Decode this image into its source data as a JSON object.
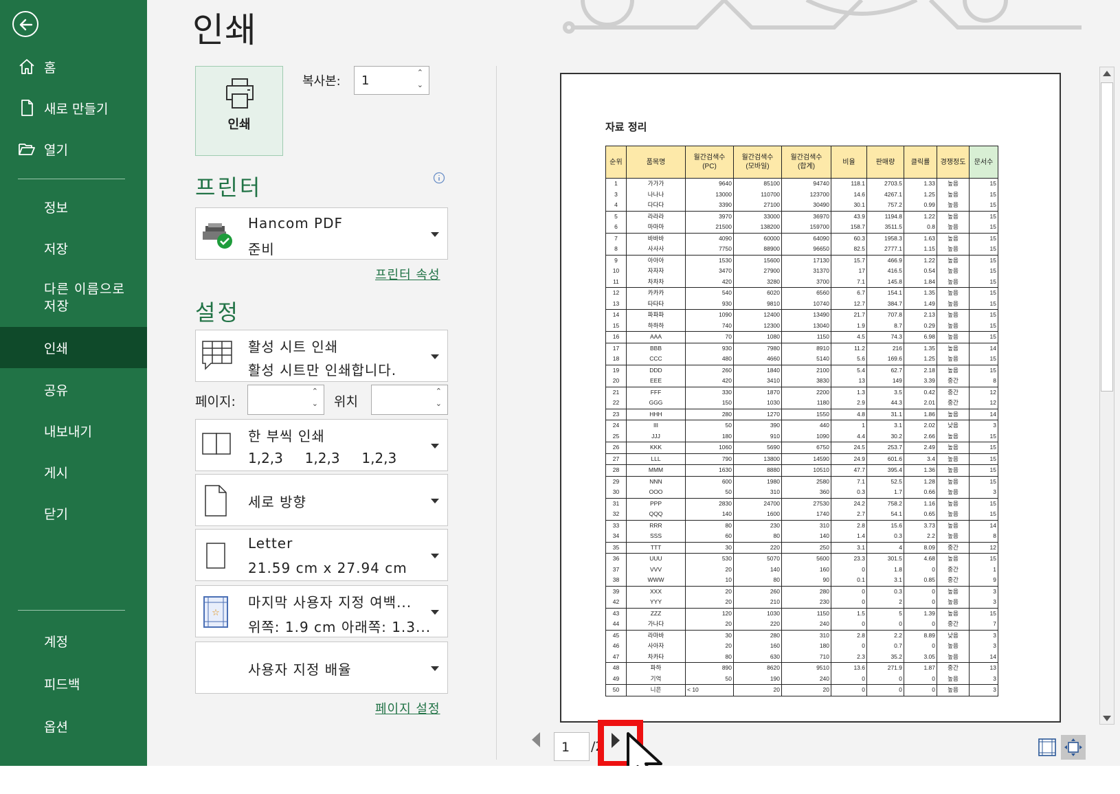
{
  "sidebar": {
    "back_icon": "back-arrow-icon",
    "items": [
      {
        "label": "홈",
        "icon": "home-icon"
      },
      {
        "label": "새로 만들기",
        "icon": "new-document-icon"
      },
      {
        "label": "열기",
        "icon": "folder-open-icon"
      },
      {
        "label": "정보"
      },
      {
        "label": "저장"
      },
      {
        "label": "다른 이름으로\n저장"
      },
      {
        "label": "인쇄"
      },
      {
        "label": "공유"
      },
      {
        "label": "내보내기"
      },
      {
        "label": "게시"
      },
      {
        "label": "닫기"
      }
    ],
    "bottom_items": [
      {
        "label": "계정"
      },
      {
        "label": "피드백"
      },
      {
        "label": "옵션"
      }
    ],
    "colors": {
      "bg": "#217346",
      "selected": "#0f4a2a"
    }
  },
  "page": {
    "title": "인쇄"
  },
  "print": {
    "button_label": "인쇄",
    "copies_label": "복사본:",
    "copies_value": "1"
  },
  "printer": {
    "section_title": "프린터",
    "name": "Hancom PDF",
    "status": "준비",
    "properties_link": "프린터 속성",
    "info_icon": "info-icon"
  },
  "settings": {
    "section_title": "설정",
    "scope": {
      "line1": "활성 시트 인쇄",
      "line2": "활성 시트만 인쇄합니다."
    },
    "pages_label": "페이지:",
    "position_label": "위치",
    "collate": {
      "line1": "한 부씩 인쇄",
      "line2": "1,2,3     1,2,3     1,2,3"
    },
    "orientation": {
      "line1": "세로 방향"
    },
    "paper": {
      "line1": "Letter",
      "line2": "21.59 cm x 27.94 cm"
    },
    "margins": {
      "line1": "마지막 사용자 지정 여백...",
      "line2": "위쪽: 1.9 cm 아래쪽: 1.3..."
    },
    "scaling": {
      "line1": "사용자 지정 배율"
    },
    "page_setup_link": "페이지 설정"
  },
  "preview": {
    "sheet_title": "자료 정리",
    "headers": [
      "순위",
      "품목명",
      "월간검색수\n(PC)",
      "월간검색수\n(모바일)",
      "월간검색수\n(합계)",
      "비율",
      "판매량",
      "클릭률",
      "경쟁정도",
      "문서수"
    ],
    "rows": [
      [
        "1",
        "가가가",
        "9640",
        "85100",
        "94740",
        "118.1",
        "2703.5",
        "1.33",
        "높음",
        "15"
      ],
      [
        "3",
        "나나나",
        "13000",
        "110700",
        "123700",
        "14.6",
        "4267.1",
        "1.25",
        "높음",
        "15"
      ],
      [
        "4",
        "다다다",
        "3390",
        "27100",
        "30490",
        "30.1",
        "757.2",
        "0.99",
        "높음",
        "15"
      ],
      [
        "5",
        "라라라",
        "3970",
        "33000",
        "36970",
        "43.9",
        "1194.8",
        "1.22",
        "높음",
        "15"
      ],
      [
        "6",
        "마마마",
        "21500",
        "138200",
        "159700",
        "158.7",
        "3511.5",
        "0.8",
        "높음",
        "15"
      ],
      [
        "7",
        "바바바",
        "4090",
        "60000",
        "64090",
        "60.3",
        "1958.3",
        "1.63",
        "높음",
        "15"
      ],
      [
        "8",
        "사사사",
        "7750",
        "88900",
        "96650",
        "82.5",
        "2777.1",
        "1.15",
        "높음",
        "15"
      ],
      [
        "9",
        "아아아",
        "1530",
        "15600",
        "17130",
        "15.7",
        "466.9",
        "1.22",
        "높음",
        "15"
      ],
      [
        "10",
        "자자자",
        "3470",
        "27900",
        "31370",
        "17",
        "416.5",
        "0.54",
        "높음",
        "15"
      ],
      [
        "11",
        "차차차",
        "420",
        "3280",
        "3700",
        "7.1",
        "145.8",
        "1.84",
        "높음",
        "15"
      ],
      [
        "12",
        "카카카",
        "540",
        "6020",
        "6560",
        "6.7",
        "154.1",
        "1.35",
        "높음",
        "15"
      ],
      [
        "13",
        "타타타",
        "930",
        "9810",
        "10740",
        "12.7",
        "384.7",
        "1.49",
        "높음",
        "15"
      ],
      [
        "14",
        "파파파",
        "1090",
        "12400",
        "13490",
        "21.7",
        "707.8",
        "2.13",
        "높음",
        "15"
      ],
      [
        "15",
        "하하하",
        "740",
        "12300",
        "13040",
        "1.9",
        "8.7",
        "0.29",
        "높음",
        "15"
      ],
      [
        "16",
        "AAA",
        "70",
        "1080",
        "1150",
        "4.5",
        "74.3",
        "6.98",
        "높음",
        "15"
      ],
      [
        "17",
        "BBB",
        "930",
        "7980",
        "8910",
        "11.2",
        "216",
        "1.35",
        "높음",
        "14"
      ],
      [
        "18",
        "CCC",
        "480",
        "4660",
        "5140",
        "5.6",
        "169.6",
        "1.25",
        "높음",
        "15"
      ],
      [
        "19",
        "DDD",
        "260",
        "1840",
        "2100",
        "5.4",
        "62.7",
        "2.18",
        "높음",
        "15"
      ],
      [
        "20",
        "EEE",
        "420",
        "3410",
        "3830",
        "13",
        "149",
        "3.39",
        "중간",
        "8"
      ],
      [
        "21",
        "FFF",
        "330",
        "1870",
        "2200",
        "1.3",
        "3.5",
        "0.42",
        "중간",
        "12"
      ],
      [
        "22",
        "GGG",
        "150",
        "1030",
        "1180",
        "2.9",
        "44.3",
        "2.01",
        "중간",
        "12"
      ],
      [
        "23",
        "HHH",
        "280",
        "1270",
        "1550",
        "4.8",
        "31.1",
        "1.86",
        "높음",
        "14"
      ],
      [
        "24",
        "III",
        "50",
        "390",
        "440",
        "1",
        "3.1",
        "2.02",
        "낮음",
        "3"
      ],
      [
        "25",
        "JJJ",
        "180",
        "910",
        "1090",
        "4.4",
        "30.2",
        "2.66",
        "높음",
        "15"
      ],
      [
        "26",
        "KKK",
        "1060",
        "5690",
        "6750",
        "24.5",
        "253.7",
        "2.49",
        "높음",
        "15"
      ],
      [
        "27",
        "LLL",
        "790",
        "13800",
        "14590",
        "24.9",
        "601.6",
        "3.4",
        "높음",
        "15"
      ],
      [
        "28",
        "MMM",
        "1630",
        "8880",
        "10510",
        "47.7",
        "395.4",
        "1.36",
        "높음",
        "15"
      ],
      [
        "29",
        "NNN",
        "600",
        "1980",
        "2580",
        "7.1",
        "52.5",
        "1.28",
        "높음",
        "15"
      ],
      [
        "30",
        "OOO",
        "50",
        "310",
        "360",
        "0.3",
        "1.7",
        "0.66",
        "높음",
        "3"
      ],
      [
        "31",
        "PPP",
        "2830",
        "24700",
        "27530",
        "24.2",
        "758.2",
        "1.16",
        "높음",
        "15"
      ],
      [
        "32",
        "QQQ",
        "140",
        "1600",
        "1740",
        "2.7",
        "54.1",
        "0.65",
        "높음",
        "15"
      ],
      [
        "33",
        "RRR",
        "80",
        "230",
        "310",
        "2.8",
        "15.6",
        "3.73",
        "높음",
        "14"
      ],
      [
        "34",
        "SSS",
        "60",
        "80",
        "140",
        "1.4",
        "0.3",
        "2.2",
        "높음",
        "8"
      ],
      [
        "35",
        "TTT",
        "30",
        "220",
        "250",
        "3.1",
        "4",
        "8.09",
        "중간",
        "12"
      ],
      [
        "36",
        "UUU",
        "530",
        "5070",
        "5600",
        "23.3",
        "301.5",
        "4.68",
        "높음",
        "15"
      ],
      [
        "37",
        "VVV",
        "20",
        "140",
        "160",
        "0",
        "1.8",
        "0",
        "중간",
        "1"
      ],
      [
        "38",
        "WWW",
        "10",
        "80",
        "90",
        "0.1",
        "3.1",
        "0.85",
        "중간",
        "9"
      ],
      [
        "39",
        "XXX",
        "20",
        "260",
        "280",
        "0",
        "0.3",
        "0",
        "높음",
        "3"
      ],
      [
        "42",
        "YYY",
        "20",
        "210",
        "230",
        "0",
        "2",
        "0",
        "높음",
        "3"
      ],
      [
        "43",
        "ZZZ",
        "120",
        "1030",
        "1150",
        "1.5",
        "5",
        "1.39",
        "높음",
        "15"
      ],
      [
        "44",
        "가나다",
        "20",
        "220",
        "240",
        "0",
        "0",
        "0",
        "중간",
        "7"
      ],
      [
        "45",
        "라마바",
        "30",
        "280",
        "310",
        "2.8",
        "2.2",
        "8.89",
        "낮음",
        "3"
      ],
      [
        "46",
        "사아자",
        "20",
        "160",
        "180",
        "0",
        "0.7",
        "0",
        "높음",
        "3"
      ],
      [
        "47",
        "차카타",
        "80",
        "630",
        "710",
        "2.3",
        "35.2",
        "3.05",
        "높음",
        "14"
      ],
      [
        "48",
        "파하",
        "890",
        "8620",
        "9510",
        "13.6",
        "271.9",
        "1.87",
        "중간",
        "13"
      ],
      [
        "49",
        "기억",
        "50",
        "190",
        "240",
        "0",
        "0",
        "0",
        "높음",
        "3"
      ],
      [
        "50",
        "니은",
        "< 10",
        "20",
        "20",
        "0",
        "0",
        "0",
        "높음",
        "3"
      ]
    ],
    "header_color": "#fde9a9",
    "last_header_color": "#d8efd4"
  },
  "pager": {
    "current": "1",
    "total": "/2",
    "highlight_color": "#ee1111"
  }
}
